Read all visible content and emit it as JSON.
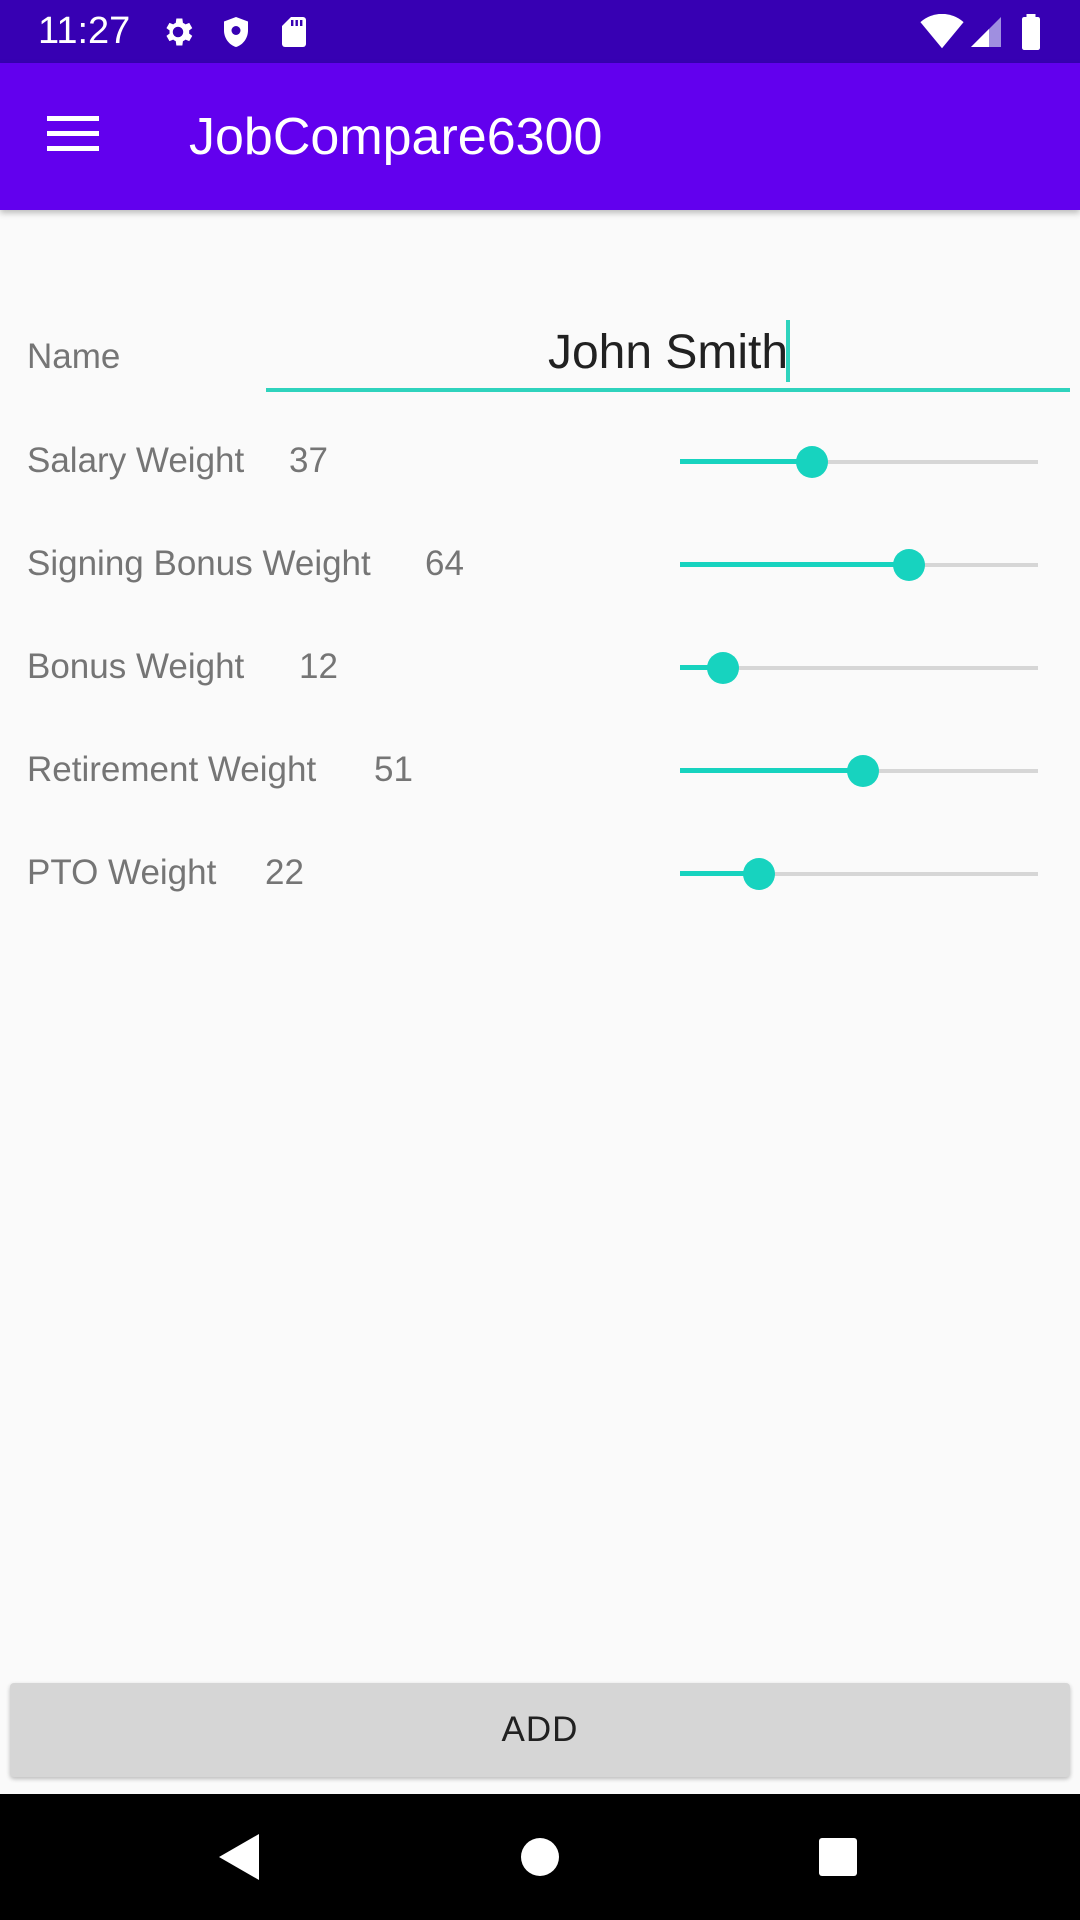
{
  "status_bar": {
    "time": "11:27",
    "icons": [
      "gear-icon",
      "shield-icon",
      "sd-card-icon",
      "wifi-icon",
      "signal-icon",
      "battery-icon"
    ]
  },
  "app_bar": {
    "title": "JobCompare6300",
    "menu_icon": "hamburger-menu-icon"
  },
  "form": {
    "name_label": "Name",
    "name_value": "John Smith",
    "weights": [
      {
        "label": "Salary Weight",
        "value": "37",
        "level": 37
      },
      {
        "label": "Signing Bonus Weight",
        "value": "64",
        "level": 64
      },
      {
        "label": "Bonus Weight",
        "value": "12",
        "level": 12
      },
      {
        "label": "Retirement Weight",
        "value": "51",
        "level": 51
      },
      {
        "label": "PTO Weight",
        "value": "22",
        "level": 22
      }
    ],
    "slider_max": 100
  },
  "actions": {
    "add_label": "ADD"
  },
  "nav_bar": {
    "icons": [
      "back-icon",
      "home-icon",
      "recents-icon"
    ]
  },
  "colors": {
    "status_bar": "#3700b3",
    "app_bar": "#6200ee",
    "accent": "#17d3bf",
    "button_bg": "#d6d6d6"
  }
}
